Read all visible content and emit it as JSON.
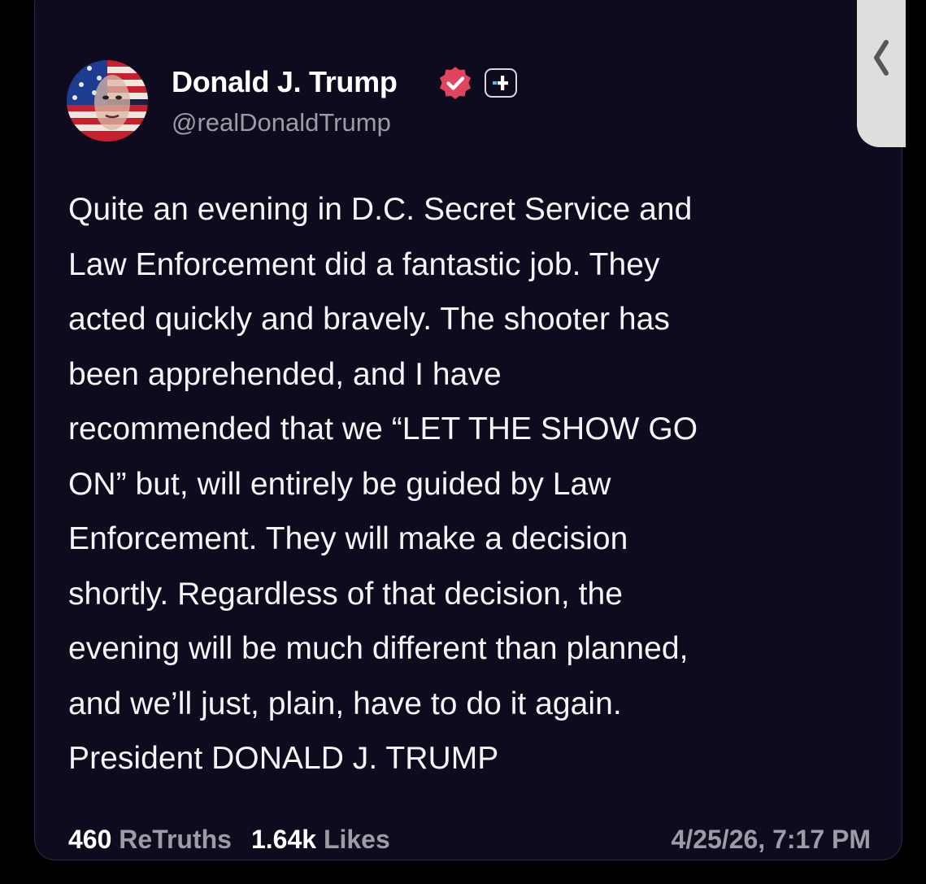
{
  "author": {
    "display_name": "Donald J. Trump",
    "handle": "@realDonaldTrump",
    "verified_icon": "verified-badge-icon",
    "plus_icon": "plus-badge-icon",
    "badge_color": "#e0445f"
  },
  "post": {
    "lines": [
      "Quite an evening in D.C. Secret Service and",
      "Law Enforcement did a fantastic job. They",
      "acted quickly and bravely. The shooter has",
      "been apprehended, and I have",
      "recommended that we “LET THE SHOW GO",
      "ON” but, will entirely be guided by Law",
      "Enforcement. They will make a decision",
      "shortly. Regardless of that decision, the",
      "evening will be much different than planned,",
      "and we’ll just, plain, have to do it again.",
      "President DONALD J. TRUMP"
    ]
  },
  "stats": {
    "retruths_count": "460",
    "retruths_label": "ReTruths",
    "likes_count": "1.64k",
    "likes_label": "Likes",
    "timestamp": "4/25/26, 7:17 PM"
  },
  "side_tab": {
    "icon": "chevron-left-icon"
  },
  "colors": {
    "background": "#000000",
    "card": "#0d0b1d",
    "text": "#f4f4f6",
    "muted": "#9d9ba6"
  }
}
